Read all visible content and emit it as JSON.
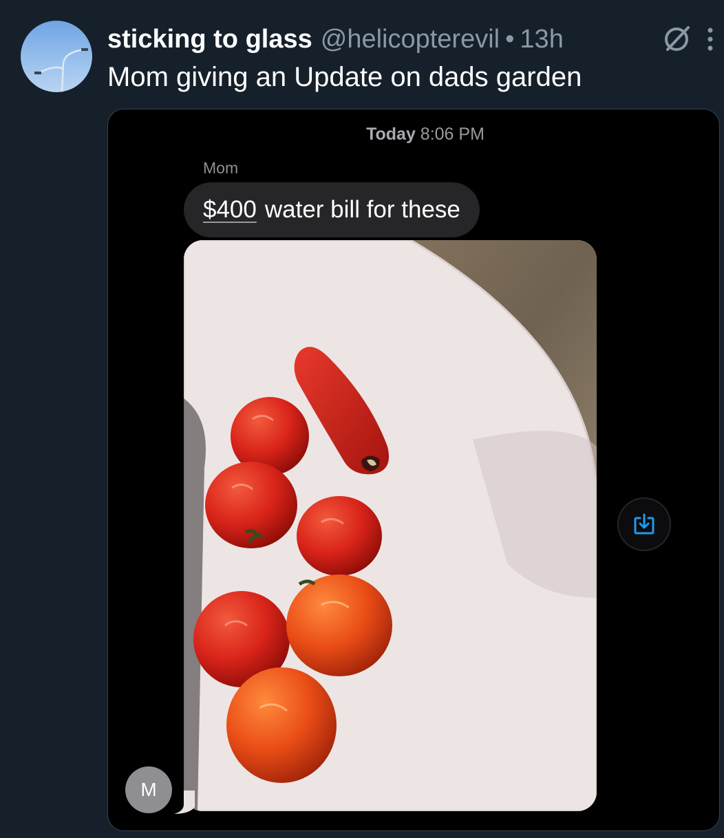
{
  "tweet": {
    "display_name": "sticking to glass",
    "handle": "@helicopterevil",
    "separator": "•",
    "time_ago": "13h",
    "text": "Mom giving an Update on dads garden",
    "icons": [
      "avatar-streetlight",
      "grok-icon",
      "more-vertical-icon"
    ]
  },
  "message": {
    "day": "Today",
    "time": "8:06 PM",
    "sender": "Mom",
    "amount": "$400",
    "text_rest": "water bill for these",
    "avatar_initial": "M",
    "icons": [
      "save-image-icon"
    ]
  },
  "colors": {
    "background": "#15202b",
    "secondary_text": "#8b98a5",
    "imessage_bubble": "#262628",
    "save_icon": "#1d9bf0"
  }
}
